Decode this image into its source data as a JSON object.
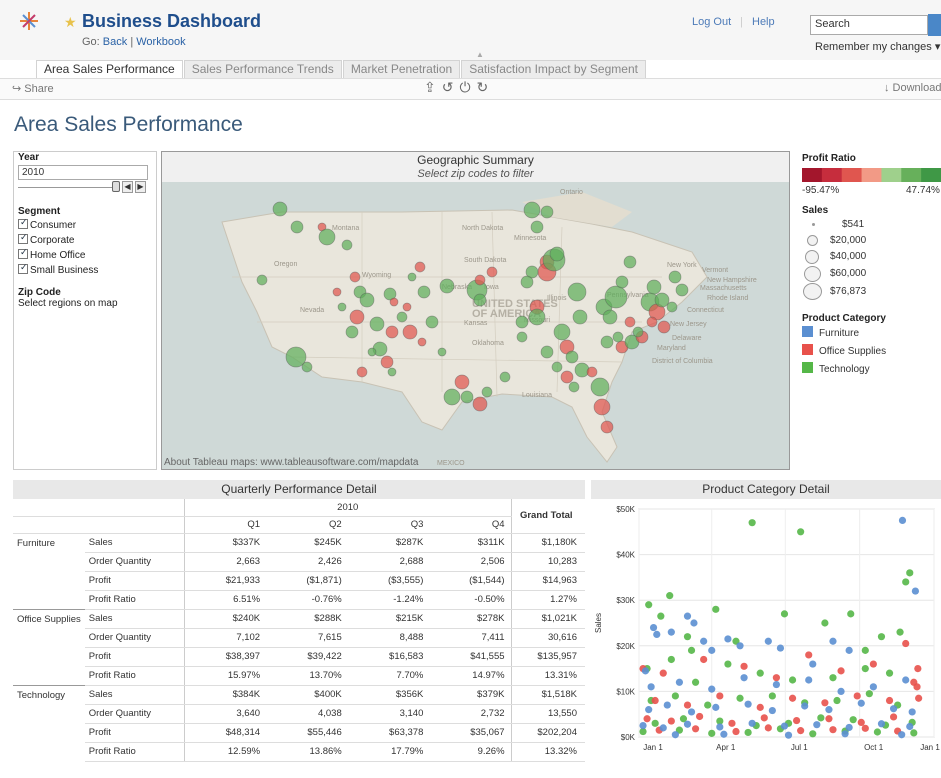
{
  "header": {
    "title": "Business Dashboard",
    "go_prefix": "Go:",
    "go_back": "Back",
    "go_sep": "|",
    "go_workbook": "Workbook",
    "logout": "Log Out",
    "help": "Help",
    "search_value": "Search",
    "remember": "Remember my changes ▾"
  },
  "tabs": [
    {
      "label": "Area Sales Performance",
      "active": true
    },
    {
      "label": "Sales Performance Trends",
      "active": false
    },
    {
      "label": "Market Penetration",
      "active": false
    },
    {
      "label": "Satisfaction Impact by Segment",
      "active": false
    }
  ],
  "toolbar": {
    "share": "↪ Share",
    "icons": "⇪↺⏻↻",
    "download": "↓ Download"
  },
  "page_title": "Area Sales Performance",
  "filters": {
    "year_label": "Year",
    "year_value": "2010",
    "segment_label": "Segment",
    "segments": [
      "Consumer",
      "Corporate",
      "Home Office",
      "Small Business"
    ],
    "zip_label": "Zip Code",
    "zip_note": "Select regions on map"
  },
  "map": {
    "title": "Geographic Summary",
    "subtitle": "Select zip codes to filter",
    "credit": "About Tableau maps: www.tableausoftware.com/mapdata",
    "labels": [
      "Ontario",
      "North Dakota",
      "Montana",
      "Minnesota",
      "South Dakota",
      "Wyoming",
      "Oregon",
      "Nevada",
      "Nebraska",
      "Iowa",
      "Illinois",
      "UNITED STATES",
      "OF AMERICA",
      "Kansas",
      "Oklahoma",
      "Missouri",
      "Pennsylvania",
      "New York",
      "Vermont",
      "New Hampshire",
      "Massachusetts",
      "Rhode Island",
      "Connecticut",
      "New Jersey",
      "Delaware",
      "Maryland",
      "District of Columbia",
      "Louisiana",
      "MEXICO"
    ]
  },
  "legends": {
    "profit_ratio_label": "Profit Ratio",
    "profit_ratio_min": "-95.47%",
    "profit_ratio_max": "47.74%",
    "profit_ratio_colors": [
      "#a3162c",
      "#c62d3d",
      "#e0564f",
      "#f29a86",
      "#9fd08c",
      "#67b05b",
      "#3f9846"
    ],
    "sales_label": "Sales",
    "sales_sizes": [
      "$541",
      "$20,000",
      "$40,000",
      "$60,000",
      "$76,873"
    ],
    "category_label": "Product Category",
    "categories": [
      {
        "name": "Furniture",
        "color": "#5b8fd1"
      },
      {
        "name": "Office Supplies",
        "color": "#e8514b"
      },
      {
        "name": "Technology",
        "color": "#55b748"
      }
    ]
  },
  "table": {
    "title": "Quarterly Performance Detail",
    "year": "2010",
    "quarters": [
      "Q1",
      "Q2",
      "Q3",
      "Q4"
    ],
    "grand_total_label": "Grand Total",
    "groups": [
      {
        "category": "Furniture",
        "rows": [
          {
            "measure": "Sales",
            "values": [
              "$337K",
              "$245K",
              "$287K",
              "$311K"
            ],
            "total": "$1,180K"
          },
          {
            "measure": "Order Quantity",
            "values": [
              "2,663",
              "2,426",
              "2,688",
              "2,506"
            ],
            "total": "10,283"
          },
          {
            "measure": "Profit",
            "values": [
              "$21,933",
              "($1,871)",
              "($3,555)",
              "($1,544)"
            ],
            "total": "$14,963"
          },
          {
            "measure": "Profit Ratio",
            "values": [
              "6.51%",
              "-0.76%",
              "-1.24%",
              "-0.50%"
            ],
            "total": "1.27%"
          }
        ]
      },
      {
        "category": "Office Supplies",
        "rows": [
          {
            "measure": "Sales",
            "values": [
              "$240K",
              "$288K",
              "$215K",
              "$278K"
            ],
            "total": "$1,021K"
          },
          {
            "measure": "Order Quantity",
            "values": [
              "7,102",
              "7,615",
              "8,488",
              "7,411"
            ],
            "total": "30,616"
          },
          {
            "measure": "Profit",
            "values": [
              "$38,397",
              "$39,422",
              "$16,583",
              "$41,555"
            ],
            "total": "$135,957"
          },
          {
            "measure": "Profit Ratio",
            "values": [
              "15.97%",
              "13.70%",
              "7.70%",
              "14.97%"
            ],
            "total": "13.31%"
          }
        ]
      },
      {
        "category": "Technology",
        "rows": [
          {
            "measure": "Sales",
            "values": [
              "$384K",
              "$400K",
              "$356K",
              "$379K"
            ],
            "total": "$1,518K"
          },
          {
            "measure": "Order Quantity",
            "values": [
              "3,640",
              "4,038",
              "3,140",
              "2,732"
            ],
            "total": "13,550"
          },
          {
            "measure": "Profit",
            "values": [
              "$48,314",
              "$55,446",
              "$63,378",
              "$35,067"
            ],
            "total": "$202,204"
          },
          {
            "measure": "Profit Ratio",
            "values": [
              "12.59%",
              "13.86%",
              "17.79%",
              "9.26%"
            ],
            "total": "13.32%"
          }
        ]
      }
    ]
  },
  "chart_data": {
    "type": "scatter",
    "title": "Product Category Detail",
    "ylabel": "Sales",
    "xlabel": "",
    "x_ticks": [
      "Jan 1",
      "Apr 1",
      "Jul 1",
      "Oct 1",
      "Jan 1"
    ],
    "y_ticks": [
      "$0K",
      "$10K",
      "$20K",
      "$30K",
      "$40K",
      "$50K"
    ],
    "ylim": [
      0,
      50000
    ],
    "x_unit": "day of year 2010",
    "grid": true,
    "series": [
      {
        "name": "Technology",
        "color": "#55b748",
        "points": [
          [
            12,
            29000
          ],
          [
            27,
            26500
          ],
          [
            38,
            31000
          ],
          [
            60,
            22000
          ],
          [
            65,
            19000
          ],
          [
            95,
            28000
          ],
          [
            120,
            21000
          ],
          [
            140,
            47000
          ],
          [
            180,
            27000
          ],
          [
            200,
            45000
          ],
          [
            230,
            25000
          ],
          [
            262,
            27000
          ],
          [
            280,
            19000
          ],
          [
            300,
            22000
          ],
          [
            323,
            23000
          ],
          [
            330,
            34000
          ],
          [
            335,
            36000
          ],
          [
            10,
            15000
          ],
          [
            40,
            17000
          ],
          [
            70,
            12000
          ],
          [
            110,
            16000
          ],
          [
            150,
            14000
          ],
          [
            190,
            12500
          ],
          [
            240,
            13000
          ],
          [
            280,
            15000
          ],
          [
            310,
            14000
          ],
          [
            15,
            8000
          ],
          [
            45,
            9000
          ],
          [
            85,
            7000
          ],
          [
            125,
            8500
          ],
          [
            165,
            9000
          ],
          [
            205,
            7500
          ],
          [
            245,
            8000
          ],
          [
            285,
            9500
          ],
          [
            320,
            7000
          ],
          [
            20,
            3000
          ],
          [
            55,
            4000
          ],
          [
            100,
            3500
          ],
          [
            145,
            2500
          ],
          [
            185,
            3000
          ],
          [
            225,
            4200
          ],
          [
            265,
            3800
          ],
          [
            305,
            2600
          ],
          [
            338,
            3200
          ],
          [
            5,
            1200
          ],
          [
            50,
            1500
          ],
          [
            90,
            800
          ],
          [
            135,
            1000
          ],
          [
            175,
            1800
          ],
          [
            215,
            700
          ],
          [
            255,
            1300
          ],
          [
            295,
            1100
          ],
          [
            340,
            900
          ]
        ]
      },
      {
        "name": "Office Supplies",
        "color": "#e8514b",
        "points": [
          [
            5,
            15000
          ],
          [
            30,
            14000
          ],
          [
            80,
            17000
          ],
          [
            130,
            15500
          ],
          [
            170,
            13000
          ],
          [
            210,
            18000
          ],
          [
            250,
            14500
          ],
          [
            290,
            16000
          ],
          [
            330,
            20500
          ],
          [
            345,
            15000
          ],
          [
            340,
            12000
          ],
          [
            20,
            8000
          ],
          [
            60,
            7000
          ],
          [
            100,
            9000
          ],
          [
            150,
            6500
          ],
          [
            190,
            8500
          ],
          [
            230,
            7500
          ],
          [
            270,
            9000
          ],
          [
            310,
            8000
          ],
          [
            10,
            4000
          ],
          [
            40,
            3500
          ],
          [
            75,
            4500
          ],
          [
            115,
            3000
          ],
          [
            155,
            4200
          ],
          [
            195,
            3600
          ],
          [
            235,
            4000
          ],
          [
            275,
            3200
          ],
          [
            315,
            4400
          ],
          [
            25,
            1500
          ],
          [
            70,
            1800
          ],
          [
            120,
            1200
          ],
          [
            160,
            2000
          ],
          [
            200,
            1400
          ],
          [
            240,
            1600
          ],
          [
            280,
            1900
          ],
          [
            320,
            1300
          ],
          [
            346,
            8500
          ],
          [
            344,
            11000
          ]
        ]
      },
      {
        "name": "Furniture",
        "color": "#5b8fd1",
        "points": [
          [
            8,
            14500
          ],
          [
            18,
            24000
          ],
          [
            22,
            22500
          ],
          [
            40,
            23000
          ],
          [
            60,
            26500
          ],
          [
            68,
            25000
          ],
          [
            80,
            21000
          ],
          [
            90,
            19000
          ],
          [
            110,
            21500
          ],
          [
            125,
            20000
          ],
          [
            160,
            21000
          ],
          [
            175,
            19500
          ],
          [
            215,
            16000
          ],
          [
            240,
            21000
          ],
          [
            260,
            19000
          ],
          [
            326,
            47500
          ],
          [
            342,
            32000
          ],
          [
            15,
            11000
          ],
          [
            50,
            12000
          ],
          [
            90,
            10500
          ],
          [
            130,
            13000
          ],
          [
            170,
            11500
          ],
          [
            210,
            12500
          ],
          [
            250,
            10000
          ],
          [
            290,
            11000
          ],
          [
            330,
            12500
          ],
          [
            12,
            6000
          ],
          [
            35,
            7000
          ],
          [
            65,
            5500
          ],
          [
            95,
            6500
          ],
          [
            135,
            7200
          ],
          [
            165,
            5800
          ],
          [
            205,
            6800
          ],
          [
            235,
            6000
          ],
          [
            275,
            7400
          ],
          [
            315,
            6200
          ],
          [
            338,
            5500
          ],
          [
            5,
            2500
          ],
          [
            30,
            2000
          ],
          [
            60,
            2800
          ],
          [
            100,
            2200
          ],
          [
            140,
            3000
          ],
          [
            180,
            2400
          ],
          [
            220,
            2700
          ],
          [
            260,
            2100
          ],
          [
            300,
            2900
          ],
          [
            335,
            2300
          ],
          [
            45,
            500
          ],
          [
            105,
            600
          ],
          [
            185,
            400
          ],
          [
            255,
            700
          ],
          [
            325,
            500
          ]
        ]
      }
    ]
  }
}
